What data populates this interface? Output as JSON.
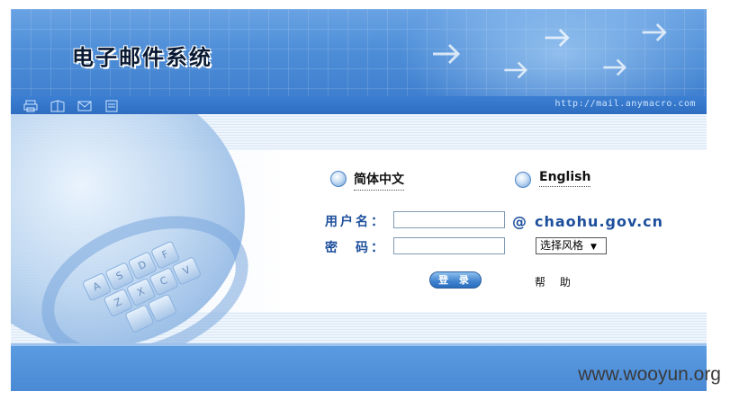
{
  "header": {
    "title": "电子邮件系统",
    "url": "http://mail.anymacro.com",
    "toolbar_icons": [
      "print-icon",
      "book-icon",
      "mail-icon",
      "document-icon"
    ]
  },
  "login": {
    "lang_chinese": "简体中文",
    "lang_english": "English",
    "username_label": "用户名：",
    "username_value": "",
    "at_sign": "@",
    "domain": "chaohu.gov.cn",
    "password_label": "密　码：",
    "password_value": "",
    "style_select": "选择风格",
    "login_button": "登 录",
    "help_link": "帮 助"
  },
  "watermark": "www.wooyun.org",
  "colors": {
    "banner": "#4f8fd8",
    "label_blue": "#1d4f9c",
    "footer": "#4a8ad6"
  }
}
